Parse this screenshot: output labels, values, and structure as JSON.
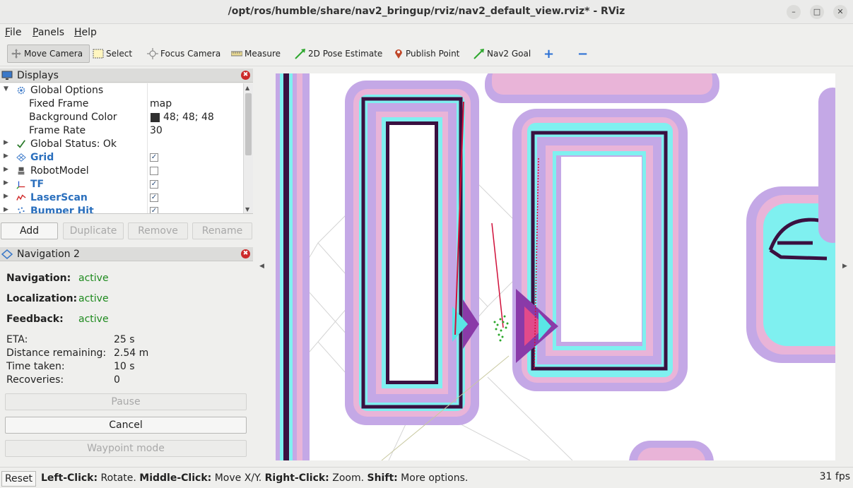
{
  "window": {
    "title": "/opt/ros/humble/share/nav2_bringup/rviz/nav2_default_view.rviz* - RViz",
    "minimize_glyph": "–",
    "maximize_glyph": "□",
    "close_glyph": "✕"
  },
  "menu": {
    "file": {
      "accel": "F",
      "rest": "ile"
    },
    "panels": {
      "accel": "P",
      "rest": "anels"
    },
    "help": {
      "accel": "H",
      "rest": "elp"
    }
  },
  "toolbar": {
    "move_camera": "Move Camera",
    "select": "Select",
    "focus_camera": "Focus Camera",
    "measure": "Measure",
    "pose_estimate": "2D Pose Estimate",
    "publish_point": "Publish Point",
    "nav2_goal": "Nav2 Goal",
    "add_glyph": "+",
    "remove_glyph": "−"
  },
  "displays": {
    "title": "Displays",
    "close_glyph": "✖",
    "rows": {
      "global_options": "Global Options",
      "fixed_frame": {
        "label": "Fixed Frame",
        "value": "map"
      },
      "background_color": {
        "label": "Background Color",
        "value": "48; 48; 48",
        "swatch": "#303030"
      },
      "frame_rate": {
        "label": "Frame Rate",
        "value": "30"
      },
      "global_status": "Global Status: Ok",
      "grid": {
        "label": "Grid",
        "checked": true
      },
      "robot_model": {
        "label": "RobotModel",
        "checked": false
      },
      "tf": {
        "label": "TF",
        "checked": true
      },
      "laser_scan": {
        "label": "LaserScan",
        "checked": true
      },
      "bumper_hit": {
        "label": "Bumper Hit",
        "checked": true
      }
    },
    "check_glyph": "✓",
    "buttons": {
      "add": "Add",
      "duplicate": "Duplicate",
      "remove": "Remove",
      "rename": "Rename"
    }
  },
  "navigation": {
    "title": "Navigation 2",
    "navigation_label": "Navigation:",
    "navigation_value": "active",
    "localization_label": "Localization:",
    "localization_value": "active",
    "feedback_label": "Feedback:",
    "feedback_value": "active",
    "eta_label": "ETA:",
    "eta_value": "25 s",
    "distance_label": "Distance remaining:",
    "distance_value": "2.54 m",
    "time_label": "Time taken:",
    "time_value": "10 s",
    "recoveries_label": "Recoveries:",
    "recoveries_value": "0",
    "pause_button": "Pause",
    "cancel_button": "Cancel",
    "waypoint_button": "Waypoint mode"
  },
  "statusbar": {
    "reset": "Reset",
    "hint_left_key": "Left-Click:",
    "hint_left": " Rotate. ",
    "hint_mid_key": "Middle-Click:",
    "hint_mid": " Move X/Y. ",
    "hint_right_key": "Right-Click:",
    "hint_right": " Zoom. ",
    "hint_shift_key": "Shift:",
    "hint_shift": " More options.",
    "fps": "31 fps"
  },
  "colors": {
    "costmap_outer": "#c4a8e6",
    "costmap_pink": "#e9b4d8",
    "costmap_cyan": "#7ff0f0",
    "obstacle": "#3a1040",
    "path": "#d0103a"
  }
}
